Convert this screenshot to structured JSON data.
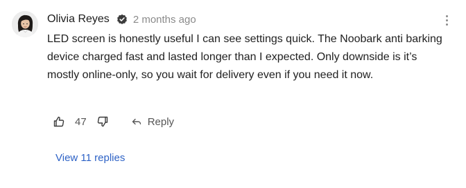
{
  "comment": {
    "author": "Olivia Reyes",
    "verified": true,
    "timestamp": "2 months ago",
    "text": "LED screen is honestly useful I can see settings quick. The Noobark anti barking device charged fast and lasted longer than I expected. Only downside is it’s mostly online-only, so you wait for delivery even if you need it now.",
    "likes": "47",
    "reply_label": "Reply",
    "view_replies_label": "View 11 replies"
  },
  "icons": {
    "verified": "verified-check-icon",
    "menu": "more-vertical-icon",
    "like": "thumbs-up-icon",
    "dislike": "thumbs-down-icon",
    "reply": "reply-arrow-icon"
  },
  "colors": {
    "link": "#2d62c6",
    "muted": "#8a8a8a",
    "verified_badge": "#3c3c3c"
  }
}
